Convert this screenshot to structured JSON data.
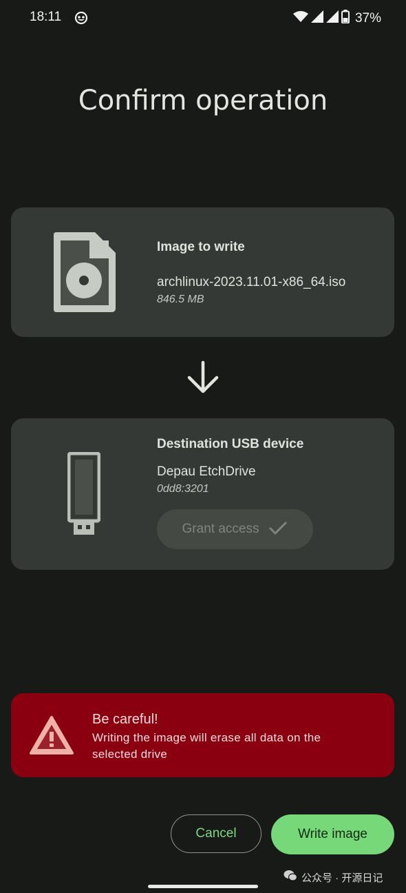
{
  "status_bar": {
    "time": "18:11",
    "battery_percent": "37%",
    "icons": [
      "app-notification-icon",
      "wifi-icon",
      "signal-icon",
      "signal-icon",
      "battery-icon"
    ]
  },
  "page": {
    "title": "Confirm operation"
  },
  "image_card": {
    "heading": "Image to write",
    "filename": "archlinux-2023.11.01-x86_64.iso",
    "size": "846.5 MB",
    "icon": "disc-image-file-icon"
  },
  "usb_card": {
    "heading": "Destination USB device",
    "device_name": "Depau EtchDrive",
    "device_id": "0dd8:3201",
    "grant_label": "Grant access",
    "icon": "usb-drive-icon"
  },
  "warning": {
    "title": "Be careful!",
    "message": "Writing the image will erase all data on the selected drive",
    "icon": "warning-icon"
  },
  "actions": {
    "cancel_label": "Cancel",
    "write_label": "Write image"
  },
  "watermark": {
    "text": "公众号 · 开源日记"
  },
  "colors": {
    "background": "#181a18",
    "card": "#353935",
    "warning": "#8b0010",
    "accent": "#76d878"
  }
}
